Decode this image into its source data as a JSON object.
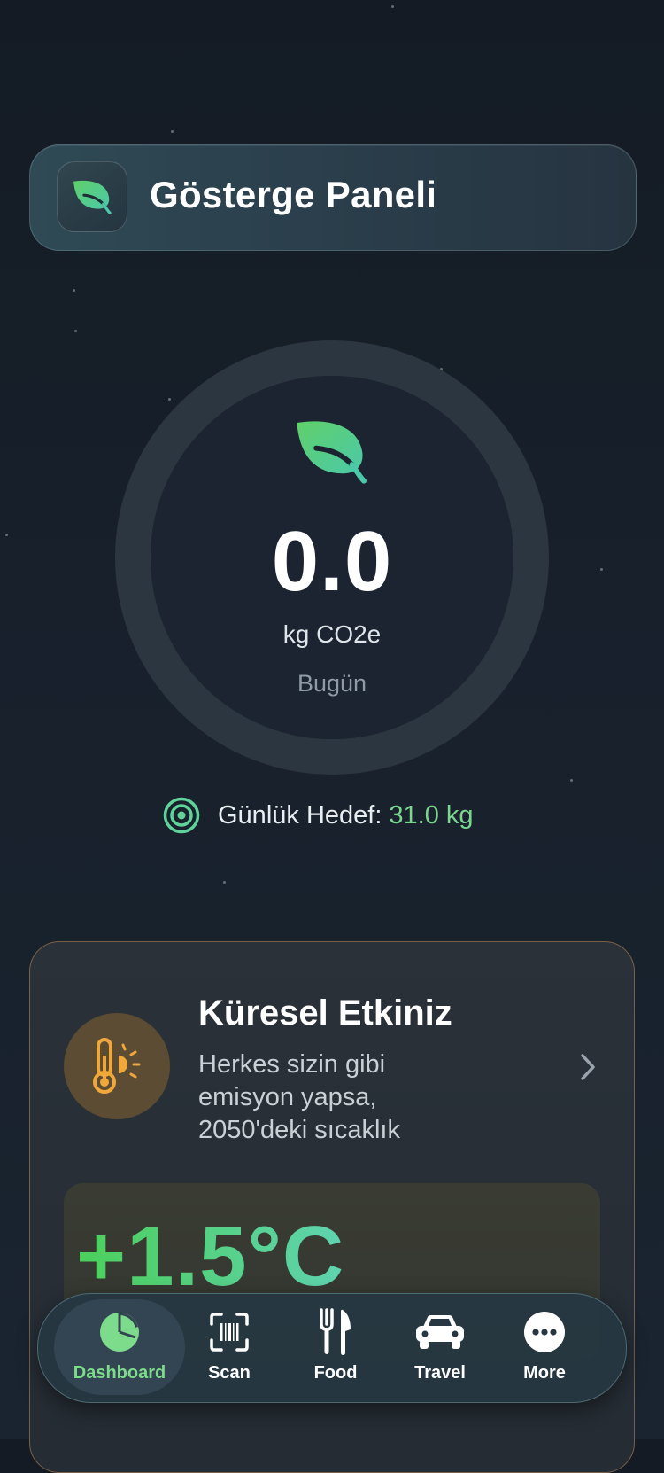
{
  "header": {
    "title": "Gösterge Paneli",
    "icon": "leaf-icon"
  },
  "summary": {
    "value": "0.0",
    "unit": "kg CO2e",
    "period": "Bugün",
    "progress_fraction": 0
  },
  "goal": {
    "label": "Günlük Hedef:",
    "value": "31.0 kg",
    "icon": "target-icon"
  },
  "global_impact": {
    "title": "Küresel Etkiniz",
    "description_lines": [
      "Herkes sizin gibi",
      "emisyon yapsa,",
      "2050'deki sıcaklık"
    ],
    "temperature": "+1.5°C",
    "icon": "thermometer-sun-icon"
  },
  "tabs": [
    {
      "label": "Dashboard",
      "icon": "pie-chart-icon",
      "active": true
    },
    {
      "label": "Scan",
      "icon": "barcode-scan-icon",
      "active": false
    },
    {
      "label": "Food",
      "icon": "fork-knife-icon",
      "active": false
    },
    {
      "label": "Travel",
      "icon": "car-icon",
      "active": false
    },
    {
      "label": "More",
      "icon": "more-dots-icon",
      "active": false
    }
  ],
  "colors": {
    "accent_green": "#7bd68f",
    "sun_orange": "#f0a83a",
    "ring_track": "#2b3640"
  }
}
